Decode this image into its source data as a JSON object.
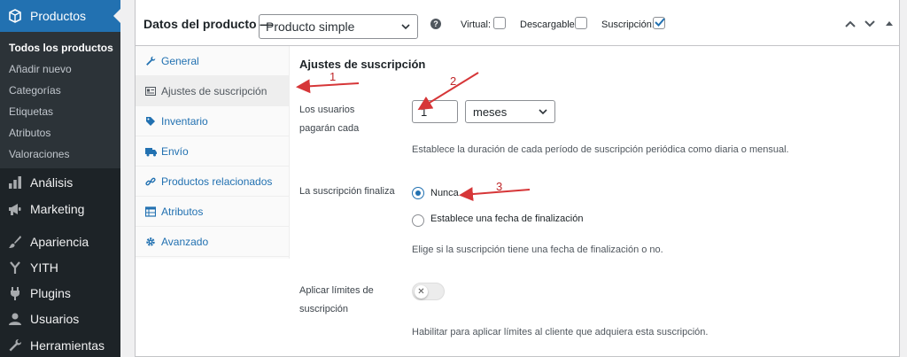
{
  "sidebar": {
    "current": {
      "label": "Productos",
      "icon": "woo-cube-icon"
    },
    "submenu": [
      {
        "label": "Todos los productos",
        "active": true
      },
      {
        "label": "Añadir nuevo"
      },
      {
        "label": "Categorías"
      },
      {
        "label": "Etiquetas"
      },
      {
        "label": "Atributos"
      },
      {
        "label": "Valoraciones"
      }
    ],
    "items": [
      {
        "label": "Análisis",
        "icon": "bar-chart-icon"
      },
      {
        "label": "Marketing",
        "icon": "megaphone-icon"
      },
      {
        "label": "Apariencia",
        "icon": "paintbrush-icon"
      },
      {
        "label": "YITH",
        "icon": "yith-icon"
      },
      {
        "label": "Plugins",
        "icon": "plug-icon"
      },
      {
        "label": "Usuarios",
        "icon": "user-icon"
      },
      {
        "label": "Herramientas",
        "icon": "wrench-icon"
      }
    ]
  },
  "header": {
    "title": "Datos del producto —",
    "product_type": "Producto simple",
    "virtual_label": "Virtual:",
    "virtual_checked": false,
    "downloadable_label": "Descargable:",
    "downloadable_checked": false,
    "subscription_label": "Suscripción:",
    "subscription_checked": true
  },
  "tabs": [
    {
      "label": "General",
      "icon": "wrench-icon",
      "active": false
    },
    {
      "label": "Ajustes de suscripción",
      "icon": "subscription-icon",
      "active": true
    },
    {
      "label": "Inventario",
      "icon": "tag-icon",
      "active": false
    },
    {
      "label": "Envío",
      "icon": "truck-icon",
      "active": false
    },
    {
      "label": "Productos relacionados",
      "icon": "link-icon",
      "active": false
    },
    {
      "label": "Atributos",
      "icon": "table-icon",
      "active": false
    },
    {
      "label": "Avanzado",
      "icon": "gear-icon",
      "active": false
    }
  ],
  "options": {
    "title": "Ajustes de suscripción",
    "period_label_1": "Los usuarios",
    "period_label_2": "pagarán cada",
    "period_value": "1",
    "period_unit": "meses",
    "period_desc": "Establece la duración de cada período de suscripción periódica como diaria o mensual.",
    "end_label": "La suscripción finaliza",
    "end_option_never": "Nunca",
    "end_option_date": "Establece una fecha de finalización",
    "end_desc": "Elige si la suscripción tiene una fecha de finalización o no.",
    "limits_label_1": "Aplicar límites de",
    "limits_label_2": "suscripción",
    "limits_toggle_symbol": "✕",
    "limits_desc": "Habilitar para aplicar límites al cliente que adquiera esta suscripción."
  },
  "annotations": {
    "n1": "1",
    "n2": "2",
    "n3": "3",
    "color": "#d63638"
  }
}
